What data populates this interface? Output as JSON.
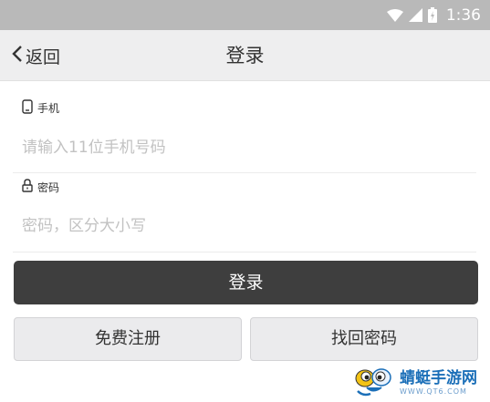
{
  "status_bar": {
    "time": "1:36",
    "icons": [
      "wifi-icon",
      "signal-icon",
      "battery-icon"
    ]
  },
  "nav": {
    "back_label": "返回",
    "title": "登录"
  },
  "form": {
    "phone": {
      "label": "手机",
      "placeholder": "请输入11位手机号码",
      "value": ""
    },
    "password": {
      "label": "密码",
      "placeholder": "密码，区分大小写",
      "value": ""
    }
  },
  "buttons": {
    "login": "登录",
    "register": "免费注册",
    "recover": "找回密码"
  },
  "watermark": {
    "name": "蜻蜓手游网",
    "url": "WWW.QT6.COM"
  },
  "colors": {
    "status_bar_bg": "#b9b9b9",
    "nav_bg": "#eeeeef",
    "primary_button": "#3e3e3e",
    "secondary_button": "#ebebed",
    "placeholder_text": "#c2c2c2",
    "watermark_blue": "#1b6fb8"
  }
}
